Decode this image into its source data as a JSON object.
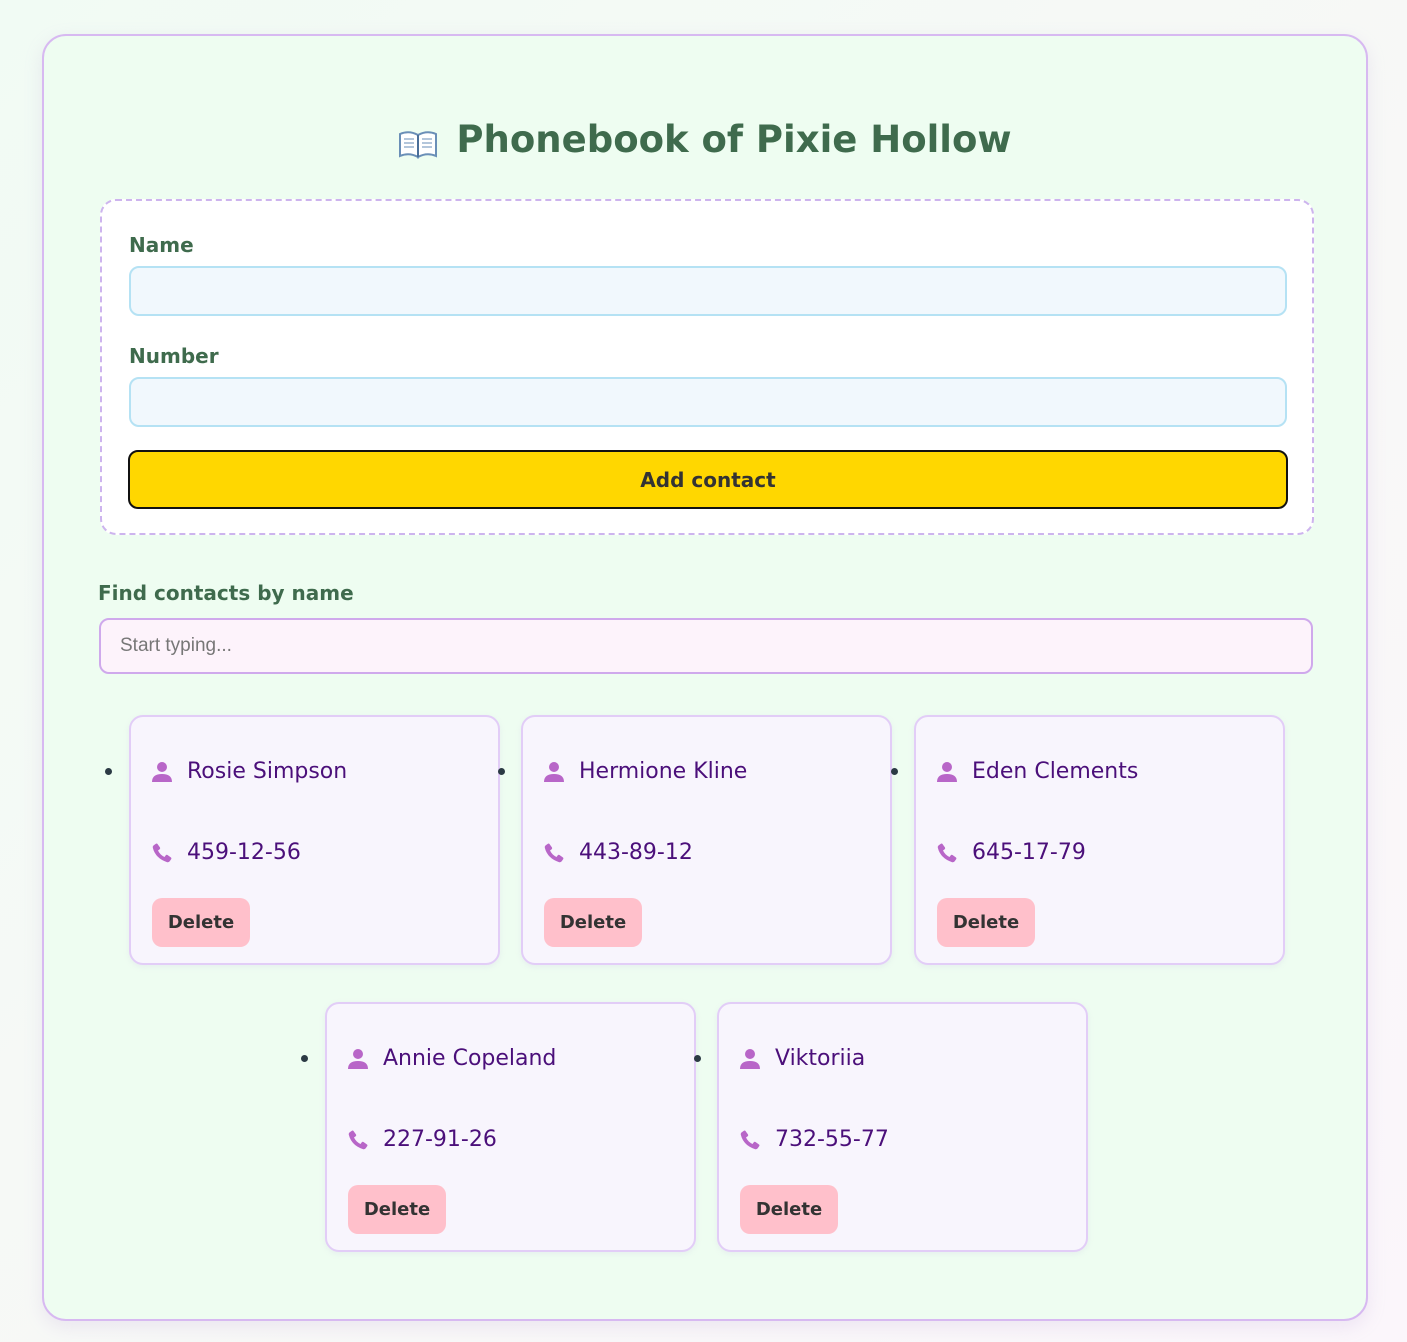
{
  "app": {
    "title": "Phonebook of Pixie Hollow",
    "title_icon": "open-book-icon"
  },
  "form": {
    "name_label": "Name",
    "name_value": "",
    "number_label": "Number",
    "number_value": "",
    "submit_label": "Add contact"
  },
  "filter": {
    "label": "Find contacts by name",
    "placeholder": "Start typing...",
    "value": ""
  },
  "contacts": [
    {
      "name": "Rosie Simpson",
      "number": "459-12-56",
      "delete_label": "Delete"
    },
    {
      "name": "Hermione Kline",
      "number": "443-89-12",
      "delete_label": "Delete"
    },
    {
      "name": "Eden Clements",
      "number": "645-17-79",
      "delete_label": "Delete"
    },
    {
      "name": "Annie Copeland",
      "number": "227-91-26",
      "delete_label": "Delete"
    },
    {
      "name": "Viktoriia",
      "number": "732-55-77",
      "delete_label": "Delete"
    }
  ],
  "icons": {
    "contact_name": "user-icon",
    "contact_phone": "phone-icon"
  },
  "colors": {
    "accent_yellow": "#ffd700",
    "delete_pink": "#ffc0cb",
    "icon_purple": "#b866c8",
    "title_green": "#3f6b4d",
    "contact_text": "#4b0f7a"
  }
}
